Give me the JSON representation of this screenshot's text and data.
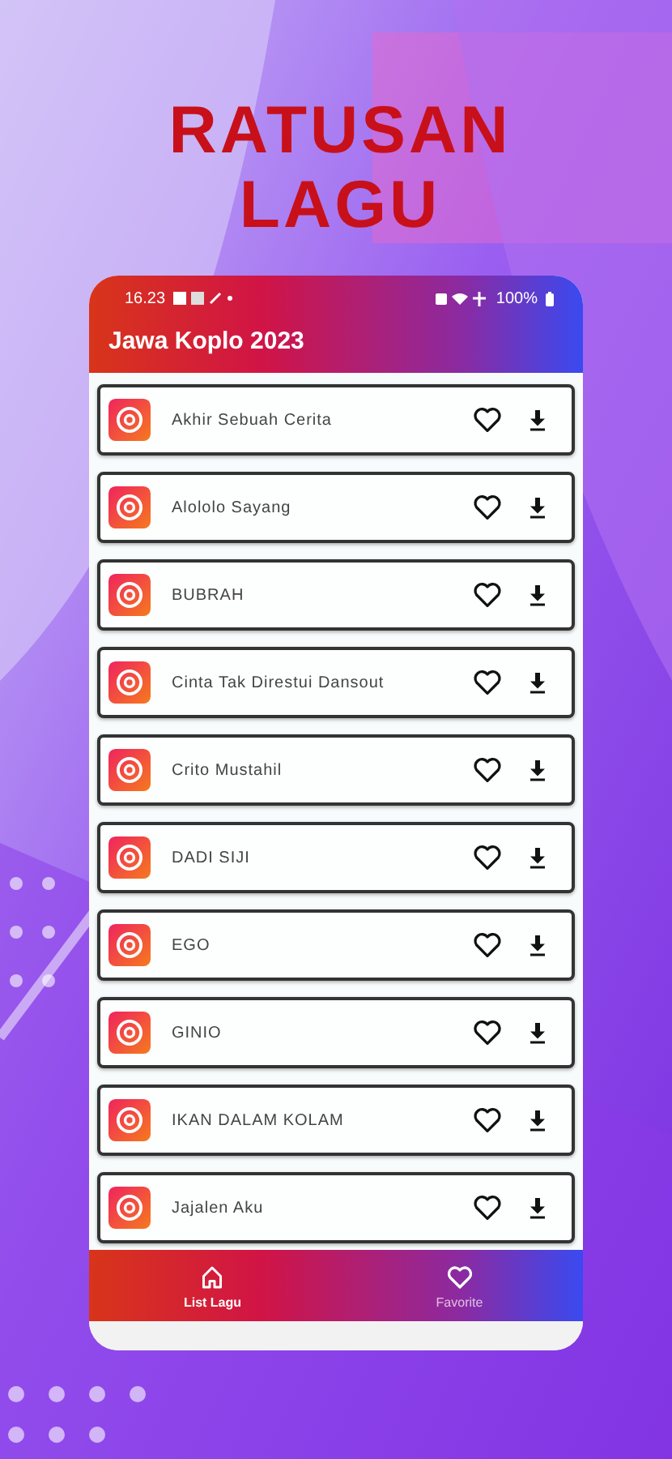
{
  "headline": [
    "RATUSAN",
    "LAGU"
  ],
  "status_bar": {
    "time": "16.23",
    "battery": "100%"
  },
  "app_bar": {
    "title": "Jawa Koplo 2023"
  },
  "songs": [
    {
      "title": "Akhir Sebuah Cerita",
      "favorite": false
    },
    {
      "title": "Alololo Sayang",
      "favorite": false
    },
    {
      "title": "BUBRAH",
      "favorite": false
    },
    {
      "title": "Cinta Tak Direstui Dansout",
      "favorite": false
    },
    {
      "title": "Crito Mustahil",
      "favorite": false
    },
    {
      "title": "DADI SIJI",
      "favorite": false
    },
    {
      "title": "EGO",
      "favorite": false
    },
    {
      "title": "GINIO",
      "favorite": false
    },
    {
      "title": "IKAN DALAM KOLAM",
      "favorite": false
    },
    {
      "title": "Jajalen Aku",
      "favorite": false
    }
  ],
  "bottom_nav": [
    {
      "label": "List Lagu",
      "selected": true
    },
    {
      "label": "Favorite",
      "selected": false
    }
  ]
}
